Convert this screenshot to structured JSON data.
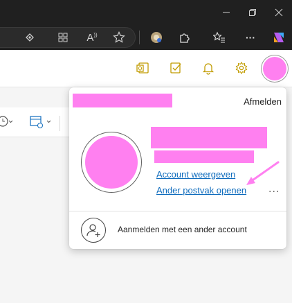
{
  "browser": {
    "window_controls": [
      "minimize-icon",
      "restore-icon",
      "close-icon"
    ],
    "toolbar_icons": [
      "eye-icon",
      "app-grid-icon",
      "read-aloud-icon",
      "favorite-star-icon",
      "extension-dot-icon",
      "puzzle-icon",
      "favorites-list-icon",
      "more-icon",
      "copilot-icon"
    ],
    "read_aloud_glyph": "A",
    "more_glyph": "···"
  },
  "outlook_header": {
    "icons": [
      "outlook-icon",
      "todo-icon",
      "bell-icon",
      "settings-icon"
    ],
    "accent_color": "#c19c00"
  },
  "account_panel": {
    "sign_out_label": "Afmelden",
    "view_account_link": "Account weergeven",
    "open_other_mailbox_link": "Ander postvak openen",
    "more_options": "...",
    "sign_in_other_label": "Aanmelden met een ander account",
    "redaction_color": "#ff80f0"
  }
}
